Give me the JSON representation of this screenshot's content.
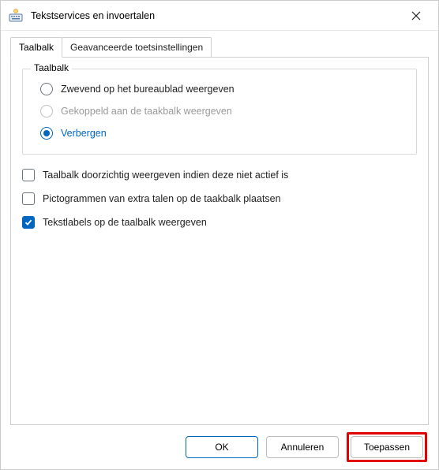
{
  "window": {
    "title": "Tekstservices en invoertalen",
    "icon_name": "keyboard-layout-icon"
  },
  "tabs": [
    {
      "label": "Taalbalk",
      "active": true
    },
    {
      "label": "Geavanceerde toetsinstellingen",
      "active": false
    }
  ],
  "groupbox": {
    "legend": "Taalbalk",
    "radios": [
      {
        "label": "Zwevend op het bureaublad weergeven",
        "state": "unselected"
      },
      {
        "label": "Gekoppeld aan de taakbalk weergeven",
        "state": "disabled"
      },
      {
        "label": "Verbergen",
        "state": "selected"
      }
    ]
  },
  "checkboxes": [
    {
      "label": "Taalbalk doorzichtig weergeven indien deze niet actief is",
      "checked": false
    },
    {
      "label": "Pictogrammen van extra talen op de taakbalk plaatsen",
      "checked": false
    },
    {
      "label": "Tekstlabels op de taalbalk weergeven",
      "checked": true
    }
  ],
  "buttons": {
    "ok": "OK",
    "cancel": "Annuleren",
    "apply": "Toepassen"
  }
}
